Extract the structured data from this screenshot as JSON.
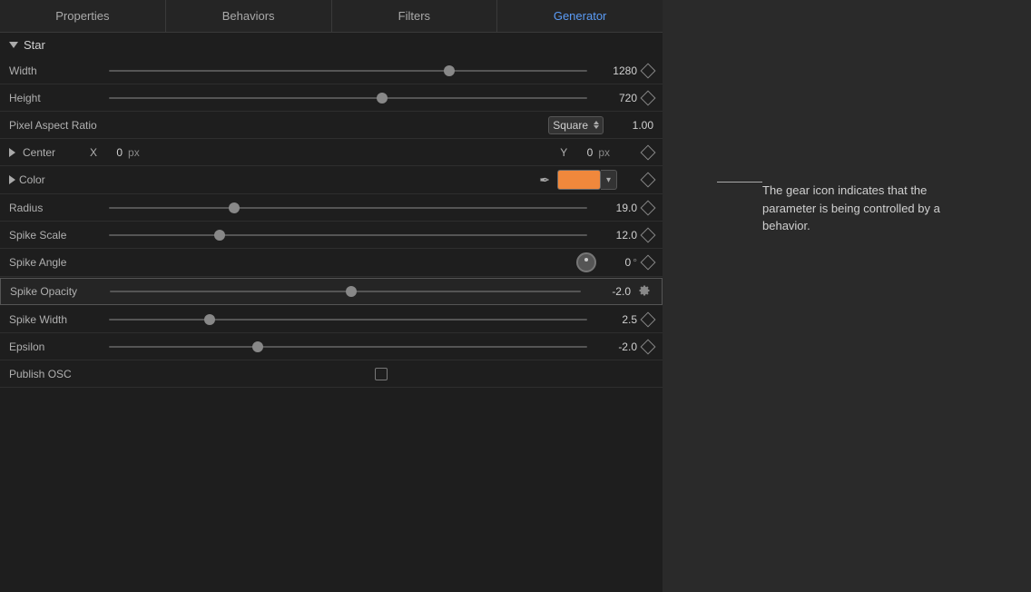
{
  "tabs": [
    {
      "label": "Properties",
      "active": false
    },
    {
      "label": "Behaviors",
      "active": false
    },
    {
      "label": "Filters",
      "active": false
    },
    {
      "label": "Generator",
      "active": true
    }
  ],
  "section": {
    "name": "Star",
    "expanded": true
  },
  "properties": {
    "width": {
      "label": "Width",
      "value": "1280",
      "sliderPos": "70%"
    },
    "height": {
      "label": "Height",
      "value": "720",
      "sliderPos": "56%"
    },
    "pixelAspectRatio": {
      "label": "Pixel Aspect Ratio",
      "dropdown": "Square",
      "value": "1.00"
    },
    "center": {
      "label": "Center",
      "x_label": "X",
      "x_value": "0",
      "x_unit": "px",
      "y_label": "Y",
      "y_value": "0",
      "y_unit": "px"
    },
    "color": {
      "label": "Color",
      "swatch": "#f0883c"
    },
    "radius": {
      "label": "Radius",
      "value": "19.0",
      "sliderPos": "25%"
    },
    "spikeScale": {
      "label": "Spike Scale",
      "value": "12.0",
      "sliderPos": "22%"
    },
    "spikeAngle": {
      "label": "Spike Angle",
      "value": "0",
      "unit": "°"
    },
    "spikeOpacity": {
      "label": "Spike Opacity",
      "value": "-2.0",
      "sliderPos": "50%",
      "highlighted": true
    },
    "spikeWidth": {
      "label": "Spike Width",
      "value": "2.5",
      "sliderPos": "20%"
    },
    "epsilon": {
      "label": "Epsilon",
      "value": "-2.0",
      "sliderPos": "30%"
    },
    "publishOSC": {
      "label": "Publish OSC"
    }
  },
  "callout": {
    "text": "The gear icon indicates that the parameter is being controlled by a behavior."
  }
}
